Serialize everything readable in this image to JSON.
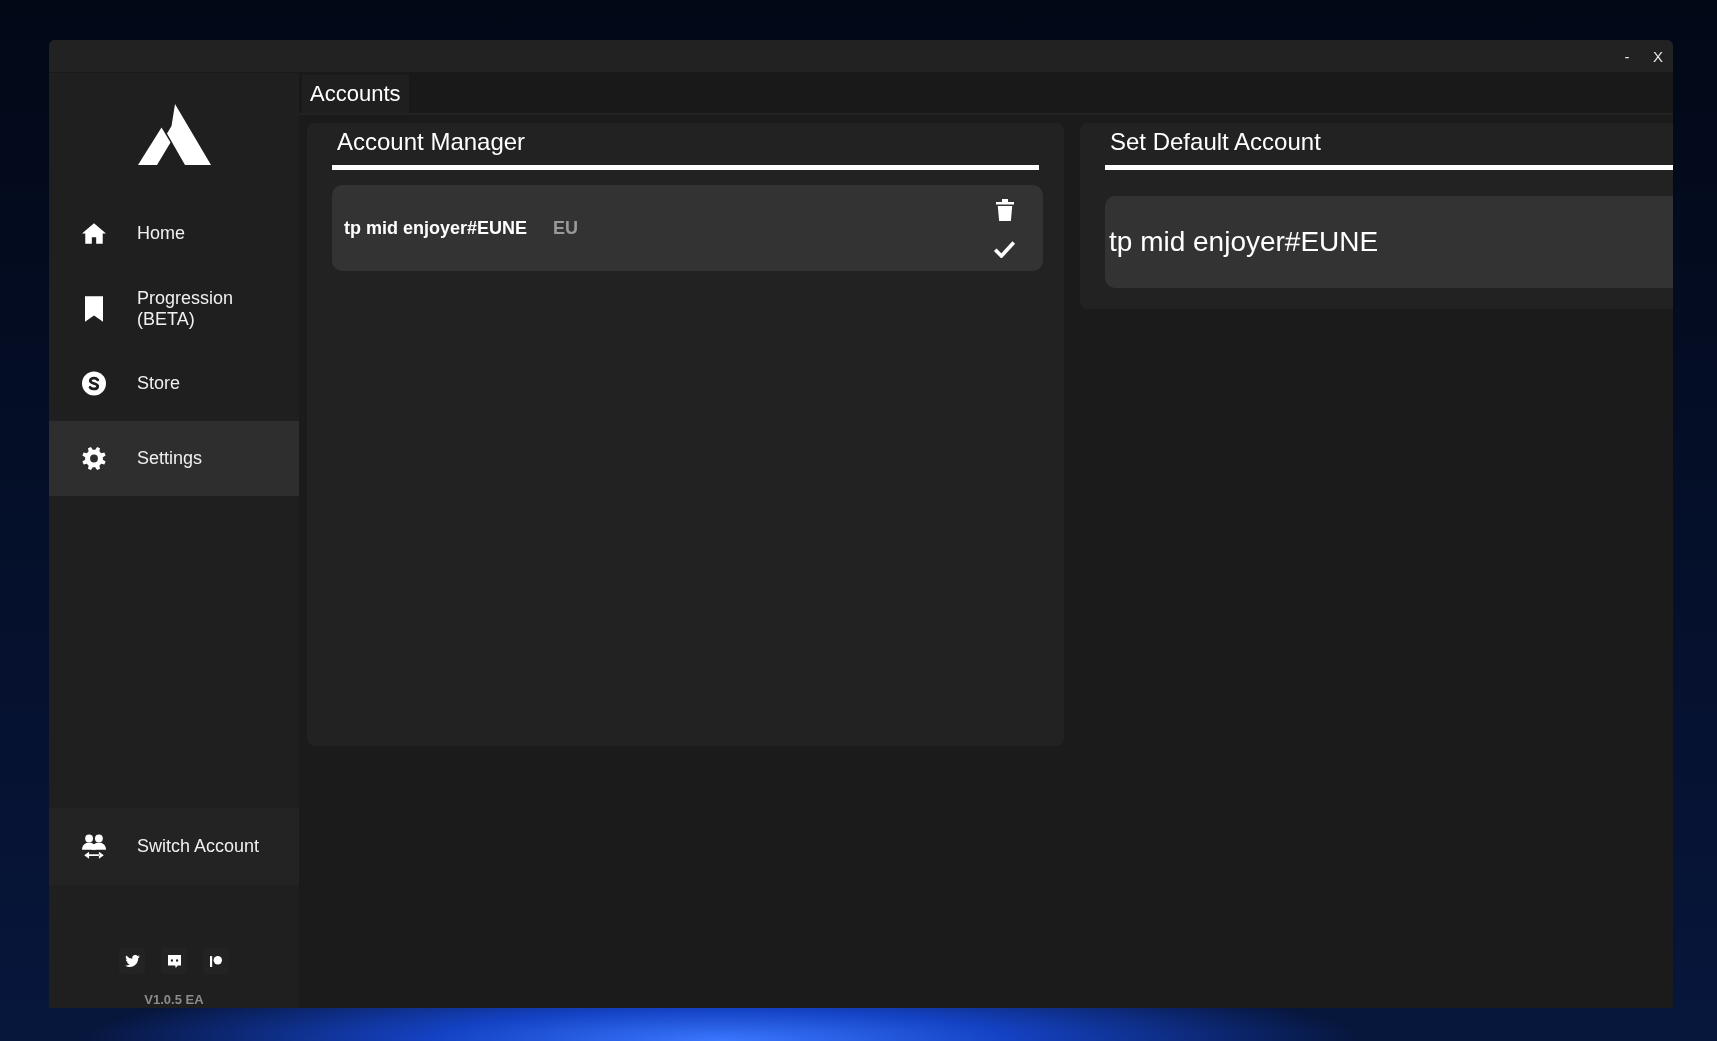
{
  "window": {
    "controls": [
      "-",
      "X"
    ]
  },
  "sidebar": {
    "items": [
      {
        "label": "Home",
        "selected": false
      },
      {
        "label": "Progression (BETA)",
        "selected": false
      },
      {
        "label": "Store",
        "selected": false
      },
      {
        "label": "Settings",
        "selected": true
      }
    ],
    "footer_button": {
      "label": "Switch Account"
    },
    "version": "V1.0.5 EA"
  },
  "tabs": [
    {
      "label": "Accounts",
      "selected": true
    }
  ],
  "account_manager": {
    "title": "Account Manager",
    "accounts": [
      {
        "name": "tp mid enjoyer#EUNE",
        "region": "EU"
      }
    ]
  },
  "default_account": {
    "title": "Set Default Account",
    "value": "tp mid enjoyer#EUNE"
  }
}
